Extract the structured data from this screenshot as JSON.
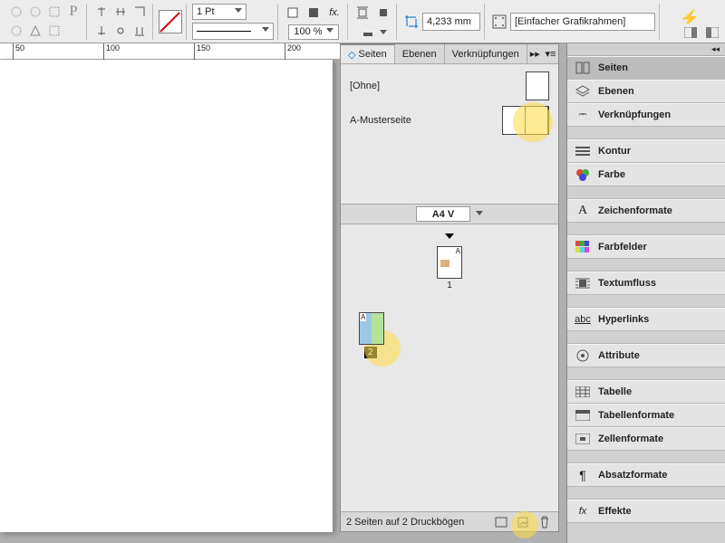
{
  "toolbar": {
    "stroke_weight": "1 Pt",
    "zoom": "100 %",
    "measure": "4,233 mm",
    "frame_label": "[Einfacher Grafikrahmen]"
  },
  "ruler": {
    "t50": "50",
    "t100": "100",
    "t150": "150",
    "t200": "200"
  },
  "pages_panel": {
    "tabs": {
      "pages": "Seiten",
      "layers": "Ebenen",
      "links": "Verknüpfungen"
    },
    "masters": {
      "none": "[Ohne]",
      "a": "A-Musterseite"
    },
    "size": "A4 V",
    "page1": "1",
    "page1_corner": "A",
    "page2": "2",
    "page2_corner": "A",
    "footer": "2 Seiten auf 2 Druckbögen"
  },
  "side": {
    "seiten": "Seiten",
    "ebenen": "Ebenen",
    "verkn": "Verknüpfungen",
    "kontur": "Kontur",
    "farbe": "Farbe",
    "zeichen": "Zeichenformate",
    "farbfelder": "Farbfelder",
    "textumfluss": "Textumfluss",
    "hyperlinks": "Hyperlinks",
    "attribute": "Attribute",
    "tabelle": "Tabelle",
    "tabellenformate": "Tabellenformate",
    "zellenformate": "Zellenformate",
    "absatz": "Absatzformate",
    "effekte": "Effekte"
  }
}
